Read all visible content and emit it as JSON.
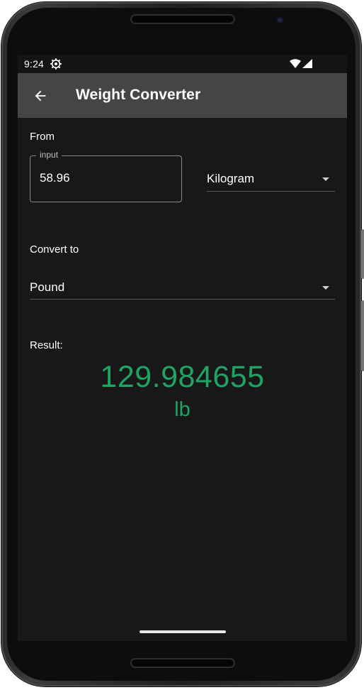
{
  "status_bar": {
    "time": "9:24",
    "settings_icon": "gear-icon",
    "wifi_icon": "wifi-icon",
    "signal_icon": "signal-icon"
  },
  "app_bar": {
    "back_icon": "arrow-left-icon",
    "title": "Weight Converter"
  },
  "from": {
    "label": "From",
    "input_label": "input",
    "input_value": "58.96",
    "unit_selected": "Kilogram"
  },
  "convert_to": {
    "label": "Convert to",
    "unit_selected": "Pound"
  },
  "result": {
    "label": "Result:",
    "value": "129.984655",
    "unit": "lb"
  },
  "colors": {
    "accent_result": "#1fa463",
    "background": "#181818",
    "app_bar": "#454545"
  }
}
